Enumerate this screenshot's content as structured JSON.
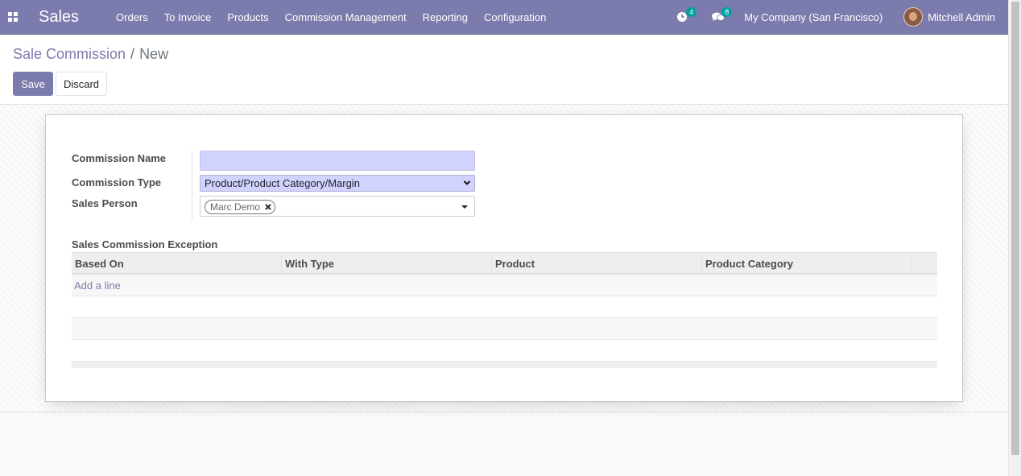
{
  "navbar": {
    "app_name": "Sales",
    "menu": [
      "Orders",
      "To Invoice",
      "Products",
      "Commission Management",
      "Reporting",
      "Configuration"
    ],
    "activity_count": "4",
    "message_count": "8",
    "company": "My Company (San Francisco)",
    "user": "Mitchell Admin",
    "icons": {
      "apps": "apps-grid-icon",
      "activity": "clock-icon",
      "messages": "chat-bubbles-icon"
    }
  },
  "breadcrumb": {
    "parent": "Sale Commission",
    "separator": "/",
    "current": "New"
  },
  "buttons": {
    "save": "Save",
    "discard": "Discard"
  },
  "form": {
    "commission_name_label": "Commission Name",
    "commission_name_value": "",
    "commission_type_label": "Commission Type",
    "commission_type_value": "Product/Product Category/Margin",
    "sales_person_label": "Sales Person",
    "sales_person_tags": [
      "Marc Demo"
    ]
  },
  "exceptions": {
    "title": "Sales Commission Exception",
    "columns": [
      "Based On",
      "With Type",
      "Product",
      "Product Category"
    ],
    "add_line": "Add a line"
  },
  "colors": {
    "brand": "#7c7bad",
    "required_field": "#d2d2ff",
    "badge": "#00a09d"
  }
}
